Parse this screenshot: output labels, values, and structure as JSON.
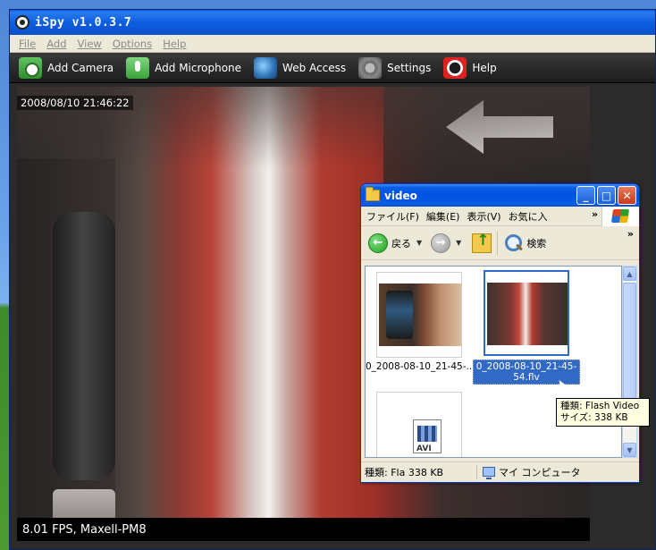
{
  "ispy": {
    "title": "iSpy v1.0.3.7",
    "menu": [
      "File",
      "Add",
      "View",
      "Options",
      "Help"
    ],
    "toolbar": [
      {
        "label": "Add Camera",
        "icon": "camera-icon"
      },
      {
        "label": "Add Microphone",
        "icon": "microphone-icon"
      },
      {
        "label": "Web Access",
        "icon": "globe-icon"
      },
      {
        "label": "Settings",
        "icon": "gear-icon"
      },
      {
        "label": "Help",
        "icon": "lifebuoy-icon"
      }
    ],
    "camera": {
      "timestamp": "2008/08/10 21:46:22",
      "status": "8.01 FPS, Maxell-PM8"
    }
  },
  "explorer": {
    "title": "video",
    "menu": [
      "ファイル(F)",
      "編集(E)",
      "表示(V)",
      "お気に入"
    ],
    "more": "»",
    "toolbar": {
      "back_label": "戻る",
      "search_label": "検索"
    },
    "files": [
      {
        "name": "0_2008-08-10_21-45-..."
      },
      {
        "name": "0_2008-08-10_21-45-54.flv"
      },
      {
        "name": "AVI"
      }
    ],
    "status": {
      "left": "種類: Fla 338 KB",
      "right": "マイ コンピュータ"
    },
    "tooltip": {
      "line1": "種類: Flash Video",
      "line2": "サイズ: 338 KB"
    }
  }
}
